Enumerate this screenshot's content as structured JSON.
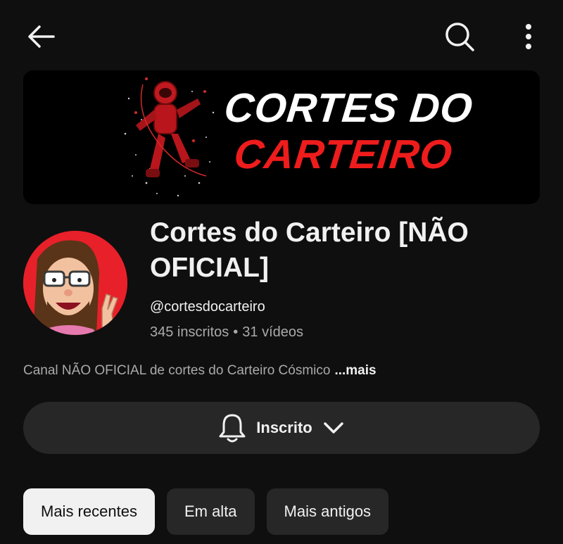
{
  "header": {
    "back_icon": "arrow-left-icon",
    "search_icon": "search-icon",
    "more_icon": "more-vertical-icon"
  },
  "banner": {
    "line1": "CORTES DO",
    "line2": "CARTEIRO",
    "colors": {
      "line1": "#ffffff",
      "line2": "#ee1c1c",
      "background": "#000000"
    }
  },
  "channel": {
    "name": "Cortes do Carteiro [NÃO OFICIAL]",
    "handle": "@cortesdocarteiro",
    "subscribers": "345 inscritos",
    "separator": "•",
    "videos": "31 vídeos",
    "description": "Canal NÃO OFICIAL de cortes do Carteiro Cósmico",
    "more_link": "...mais"
  },
  "subscribe": {
    "icon": "bell-icon",
    "label": "Inscrito",
    "dropdown_icon": "chevron-down-icon"
  },
  "filters": [
    {
      "label": "Mais recentes",
      "active": true
    },
    {
      "label": "Em alta",
      "active": false
    },
    {
      "label": "Mais antigos",
      "active": false
    }
  ],
  "colors": {
    "background": "#0f0f0f",
    "surface": "#272727",
    "text_primary": "#f1f1f1",
    "text_secondary": "#aaaaaa",
    "avatar_bg": "#e8202a"
  }
}
